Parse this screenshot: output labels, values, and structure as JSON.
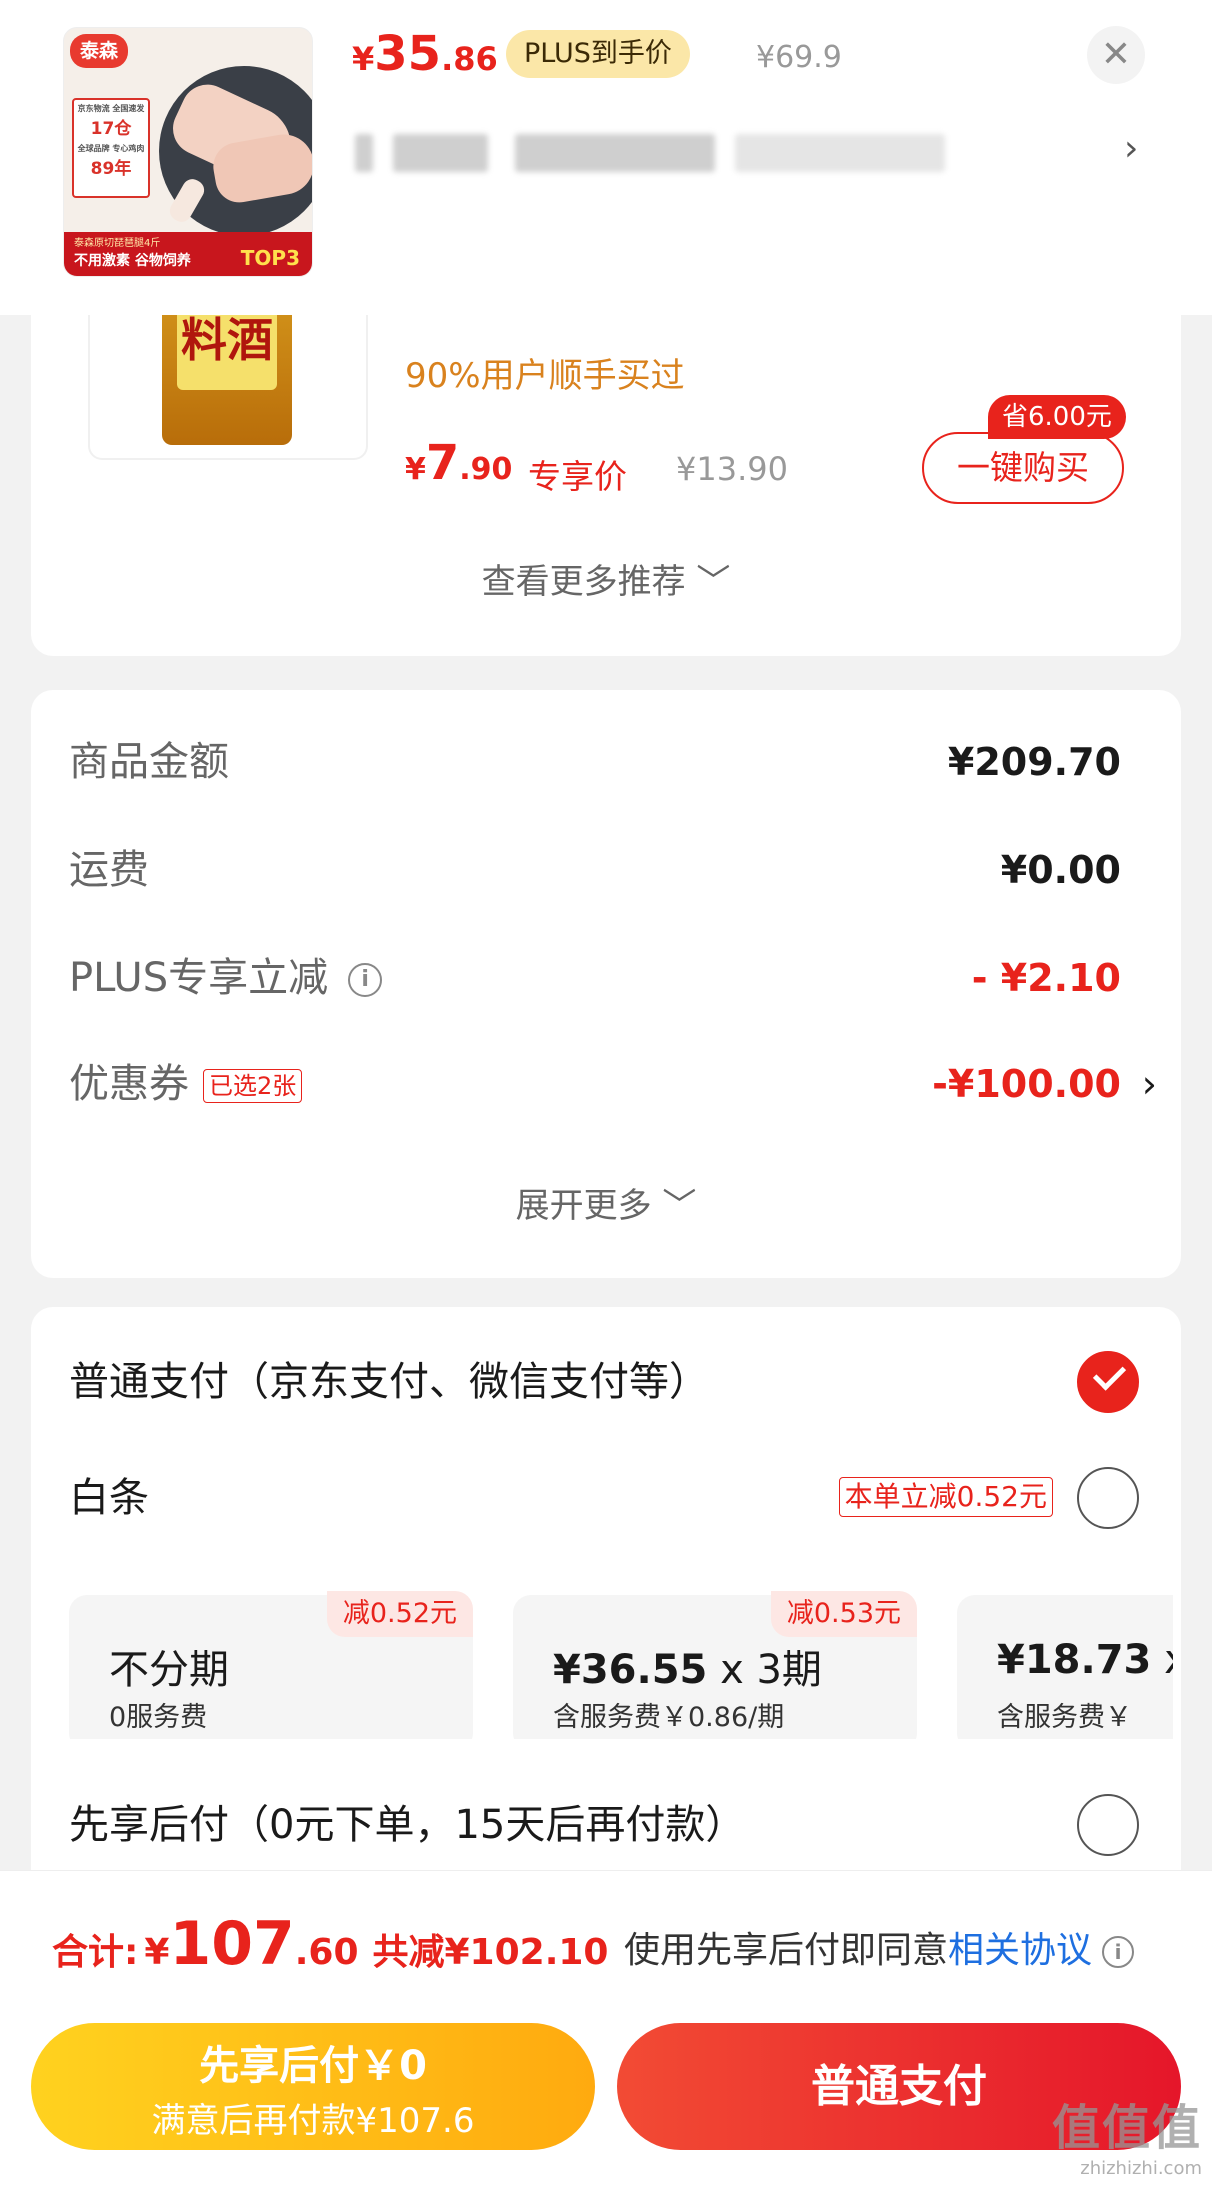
{
  "header": {
    "product_image_alt": "泰森原切琵琶腿4斤",
    "thumb_brand": "泰森",
    "thumb_badge_line1": "京东物流 全国速发",
    "thumb_badge_num1": "17仓",
    "thumb_badge_line2": "全球品牌 专心鸡肉",
    "thumb_badge_num2": "89年",
    "thumb_strip_title": "泰森原切琵琶腿4斤",
    "thumb_strip_text": "不用激素  谷物饲养",
    "thumb_strip_rank": "TOP3",
    "price_currency": "¥",
    "price_int": "35",
    "price_dec": ".86",
    "plus_label": "PLUS到手价",
    "original_price": "¥69.9",
    "close_symbol": "✕",
    "arrow_symbol": "›"
  },
  "recommend": {
    "bottle_label": "料酒",
    "hint": "90%用户顺手买过",
    "price_currency": "¥",
    "price_int": "7",
    "price_dec": ".90",
    "price_tag": "专享价",
    "original_price": "¥13.90",
    "save_label": "省6.00元",
    "buy_button": "一键购买",
    "more_label": "查看更多推荐 ﹀"
  },
  "summary": {
    "rows": [
      {
        "label": "商品金额",
        "value": "¥209.70"
      },
      {
        "label": "运费",
        "value": "¥0.00"
      },
      {
        "label": "PLUS专享立减",
        "value": "- ¥2.10"
      },
      {
        "label": "优惠券",
        "tag": "已选2张",
        "value": "-¥100.00"
      }
    ],
    "info_symbol": "i",
    "chevron_symbol": "›",
    "expand_label": "展开更多 ﹀"
  },
  "payment": {
    "normal_label": "普通支付（京东支付、微信支付等）",
    "normal_selected": true,
    "baitiao_label": "白条",
    "baitiao_tag": "本单立减0.52元",
    "plans": [
      {
        "discount": "减0.52元",
        "main": "不分期",
        "sub": "0服务费"
      },
      {
        "discount": "减0.53元",
        "main_amount": "¥36.55",
        "main_x": "x",
        "main_term": "3期",
        "sub": "含服务费￥0.86/期"
      },
      {
        "main_amount": "¥18.73",
        "main_x": "x",
        "sub": "含服务费￥"
      }
    ],
    "bnpl_label": "先享后付（0元下单，15天后再付款）"
  },
  "total_bar": {
    "label": "合计:",
    "currency": "¥",
    "amount_int": "107",
    "amount_dec": ".60",
    "saved": "共减¥102.10",
    "agree_text": "使用先享后付即同意",
    "agree_link": "相关协议",
    "info_symbol": "i"
  },
  "buttons": {
    "bnpl_line1": "先享后付￥0",
    "bnpl_line2": "满意后再付款¥107.6",
    "pay_label": "普通支付"
  },
  "watermark": {
    "text": "值值值",
    "url": "zhizhizhi.com"
  },
  "colors": {
    "accent_red": "#e8231c",
    "plus_gold": "#fbe7a8",
    "link_blue": "#1e6fe0",
    "bnpl_yellow": "#ffb514"
  }
}
